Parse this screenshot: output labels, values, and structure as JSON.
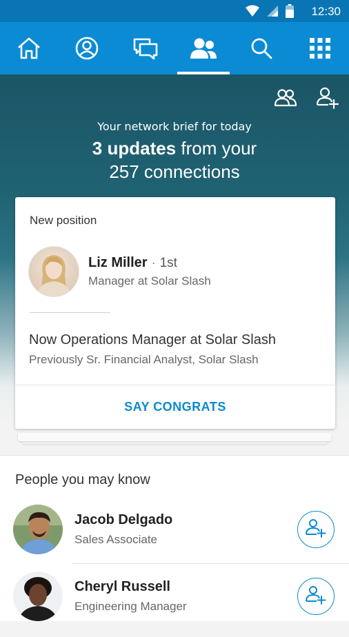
{
  "status": {
    "time": "12:30"
  },
  "nav": {
    "items": [
      {
        "id": "home",
        "icon": "home-icon",
        "active": false
      },
      {
        "id": "profile",
        "icon": "profile-icon",
        "active": false
      },
      {
        "id": "messages",
        "icon": "messages-icon",
        "active": false
      },
      {
        "id": "my-network",
        "icon": "my-network-icon",
        "active": true
      },
      {
        "id": "search",
        "icon": "search-icon",
        "active": false
      },
      {
        "id": "apps",
        "icon": "apps-grid-icon",
        "active": false
      }
    ]
  },
  "brief": {
    "subtitle": "Your network brief for today",
    "updates_bold": "3 updates",
    "updates_rest": " from your",
    "connections": "257 connections",
    "actions": [
      "connections-icon",
      "add-connection-icon"
    ]
  },
  "update_card": {
    "kind": "New position",
    "name": "Liz Miller",
    "degree": "1st",
    "title": "Manager at Solar Slash",
    "headline": "Now Operations Manager at Solar Slash",
    "previous": "Previously Sr. Financial Analyst, Solar Slash",
    "action": "SAY CONGRATS"
  },
  "pymk": {
    "title": "People you may know",
    "people": [
      {
        "name": "Jacob Delgado",
        "title": "Sales Associate"
      },
      {
        "name": "Cheryl Russell",
        "title": "Engineering Manager"
      }
    ]
  },
  "colors": {
    "nav_bg": "#0b8bd4",
    "status_bg": "#0a75b5",
    "accent": "#0a8ad0"
  }
}
